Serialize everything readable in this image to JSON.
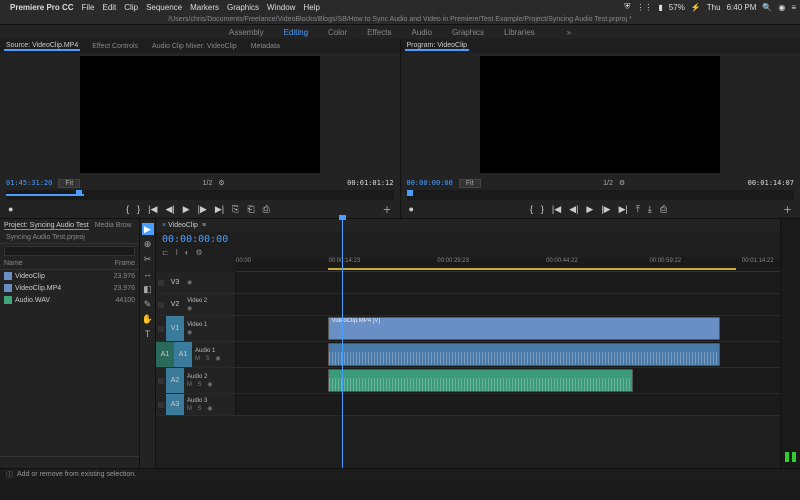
{
  "menubar": {
    "apple": "",
    "app": "Premiere Pro CC",
    "items": [
      "File",
      "Edit",
      "Clip",
      "Sequence",
      "Markers",
      "Graphics",
      "Window",
      "Help"
    ],
    "right": {
      "battery": "57%",
      "day": "Thu",
      "time": "6:40 PM"
    }
  },
  "pathbar": "/Users/chris/Documents/Freelance/VideoBlocks/Blogs/SB/How to Sync Audio and Video in Premiere/Test Example/Project/Syncing Audio Test.prproj *",
  "workspaces": {
    "items": [
      "Assembly",
      "Editing",
      "Color",
      "Effects",
      "Audio",
      "Graphics",
      "Libraries"
    ],
    "active": 1
  },
  "source": {
    "tabs": [
      "Source: VideoClip.MP4",
      "Effect Controls",
      "Audio Clip Mixer: VideoClip",
      "Metadata"
    ],
    "tc_in": "01:45:31:20",
    "fit": "Fit",
    "ratio": "1/2",
    "tc_out": "00:01:01:12"
  },
  "program": {
    "tab": "Program: VideoClip",
    "tc_in": "00:00:00:00",
    "fit": "Fit",
    "ratio": "1/2",
    "tc_out": "00:01:14:07"
  },
  "project": {
    "tabs": [
      "Project: Syncing Audio Test",
      "Media Brow"
    ],
    "name": "Syncing Audio Test.prproj",
    "headers": {
      "name": "Name",
      "frame": "Frame"
    },
    "items": [
      {
        "icon": "v",
        "name": "VideoClip",
        "frame": "23.976"
      },
      {
        "icon": "v",
        "name": "VideoClip.MP4",
        "frame": "23.976"
      },
      {
        "icon": "a",
        "name": "Audio.WAV",
        "frame": "44100"
      }
    ]
  },
  "tools": [
    "▶",
    "⊕",
    "✂",
    "↔",
    "◧",
    "✎",
    "✋",
    "T"
  ],
  "timeline": {
    "seq": "VideoClip",
    "tc": "00:00:00:00",
    "ruler": [
      "00:00",
      "00:00:14:23",
      "00:00:29:23",
      "00:00:44:22",
      "00:00:59:22",
      "00:01:14:22"
    ],
    "tracks": {
      "v3": "V3",
      "v2": "V2",
      "v2name": "Video 2",
      "v1": "V1",
      "v1name": "Video 1",
      "a1": "A1",
      "a1name": "Audio 1",
      "a2": "A2",
      "a2name": "Audio 2",
      "a3": "A3",
      "a3name": "Audio 3"
    },
    "cliplabel": "VideoClip.MP4 [V]"
  },
  "status": "Add or remove from existing selection."
}
